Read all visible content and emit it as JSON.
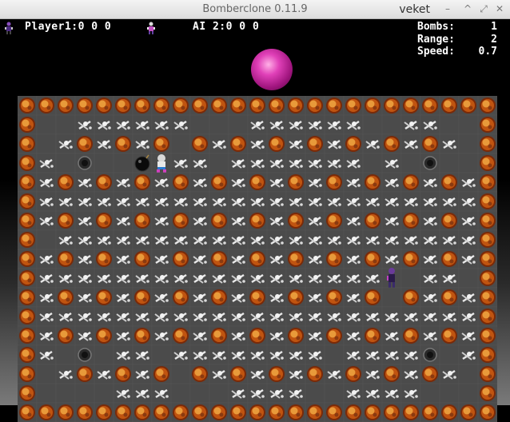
{
  "window": {
    "title": "Bomberclone  0.11.9",
    "user": "veket",
    "controls": [
      "–",
      "^",
      "⤢",
      "✕"
    ]
  },
  "hud": {
    "player1": "Player1:0 0 0",
    "ai2": "AI 2:0 0 0",
    "stats": [
      {
        "label": "Bombs:",
        "value": "1"
      },
      {
        "label": "Range:",
        "value": "2"
      },
      {
        "label": "Speed:",
        "value": "0.7"
      }
    ]
  },
  "colors": {
    "fire": "#d2691e",
    "floor": "#4b4b4b",
    "bones": "#e8e8e8",
    "orb": "#e040b8"
  },
  "board": {
    "cols": 25,
    "rows": 17,
    "icons": {
      "F": "fire-block",
      "B": "bones-block",
      "H": "floor-hole",
      "O": "bomb",
      "P": "player-1",
      "A": "ai-2",
      ".": "floor"
    },
    "map": [
      "FFFFFFFFFFFFFFFFFFFFFFFFF",
      "F..BBBBBB...BBBBBB..BB..F",
      "F.BFBFBF.FBFBFBFBFBFBFB.F",
      "FB.H..OPBB.BBBBBBB.B.H..F",
      "FBFBFBFBFBFBFBFBFBFBFBFBF",
      "FBBBBBBBBBBBBBBBBBBBBBBBF",
      "FBFBFBFBFBFBFBFBFBFBFBFBF",
      "F.BBBBBBBBBBBBBBBBBBBBBBF",
      "FBFBFBFBFBFBFBFBFBFBFBFBF",
      "FBBBBBBBBBBBBBBBBBBA.BB.F",
      "FBFBFBFBFBFBFBFBFBF.FBFBF",
      "FBBBBBBBBBBBBBBBBBBBBBBBF",
      "FBFBFBFBFBFBFBFBFBFBFBFBF",
      "FB.H.BB.BBBBBBBB.BBBBH.BF",
      "F.BFBFBF.FBFBFBFBFBFBFB.F",
      "F....BBB...BBBB..BBBB...F",
      "FFFFFFFFFFFFFFFFFFFFFFFFF"
    ]
  }
}
